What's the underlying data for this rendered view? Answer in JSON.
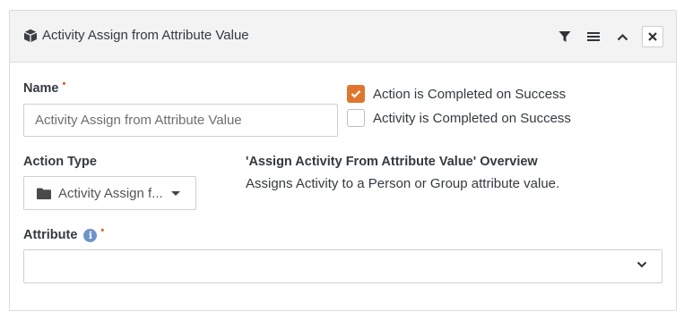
{
  "panel": {
    "title": "Activity Assign from Attribute Value",
    "icons": [
      "cube-icon",
      "filter-icon",
      "menu-icon",
      "chevron-up-icon",
      "close-icon"
    ]
  },
  "form": {
    "name_label": "Name",
    "name_value": "Activity Assign from Attribute Value",
    "required_marker": "•",
    "action_completed_label": "Action is Completed on Success",
    "action_completed_checked": true,
    "activity_completed_label": "Activity is Completed on Success",
    "activity_completed_checked": false,
    "action_type_label": "Action Type",
    "action_type_value": "Activity Assign f...",
    "overview_title": "'Assign Activity From Attribute Value' Overview",
    "overview_description": "Assigns Activity to a Person or Group attribute value.",
    "attribute_label": "Attribute",
    "attribute_value": ""
  },
  "colors": {
    "accent": "#e0762e",
    "required": "#e25c2a",
    "info": "#6f93c9",
    "header_bg": "#f3f3f3"
  }
}
